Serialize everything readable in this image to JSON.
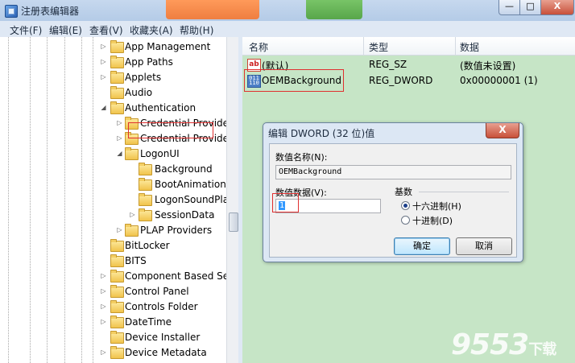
{
  "window": {
    "title": "注册表编辑器",
    "min": "—",
    "max": "□",
    "close": "X"
  },
  "menu": [
    "文件(F)",
    "编辑(E)",
    "查看(V)",
    "收藏夹(A)",
    "帮助(H)"
  ],
  "tree": [
    {
      "label": "App Management",
      "level": 0,
      "exp": "▷"
    },
    {
      "label": "App Paths",
      "level": 0,
      "exp": "▷"
    },
    {
      "label": "Applets",
      "level": 0,
      "exp": "▷"
    },
    {
      "label": "Audio",
      "level": 0,
      "exp": ""
    },
    {
      "label": "Authentication",
      "level": 0,
      "exp": "◢"
    },
    {
      "label": "Credential Provider",
      "level": 1,
      "exp": "▷"
    },
    {
      "label": "Credential Provider",
      "level": 1,
      "exp": "▷"
    },
    {
      "label": "LogonUI",
      "level": 1,
      "exp": "◢"
    },
    {
      "label": "Background",
      "level": 2,
      "exp": ""
    },
    {
      "label": "BootAnimation",
      "level": 2,
      "exp": ""
    },
    {
      "label": "LogonSoundPlay",
      "level": 2,
      "exp": ""
    },
    {
      "label": "SessionData",
      "level": 2,
      "exp": "▷"
    },
    {
      "label": "PLAP Providers",
      "level": 1,
      "exp": "▷"
    },
    {
      "label": "BitLocker",
      "level": 0,
      "exp": ""
    },
    {
      "label": "BITS",
      "level": 0,
      "exp": ""
    },
    {
      "label": "Component Based Ser",
      "level": 0,
      "exp": "▷"
    },
    {
      "label": "Control Panel",
      "level": 0,
      "exp": "▷"
    },
    {
      "label": "Controls Folder",
      "level": 0,
      "exp": "▷"
    },
    {
      "label": "DateTime",
      "level": 0,
      "exp": "▷"
    },
    {
      "label": "Device Installer",
      "level": 0,
      "exp": ""
    },
    {
      "label": "Device Metadata",
      "level": 0,
      "exp": "▷"
    }
  ],
  "list": {
    "headers": [
      "名称",
      "类型",
      "数据"
    ],
    "rows": [
      {
        "icon": "string-value-icon",
        "icon_text": "ab",
        "name": "(默认)",
        "type": "REG_SZ",
        "data": "(数值未设置)"
      },
      {
        "icon": "binary-value-icon",
        "icon_text": "011\n110",
        "name": "OEMBackground",
        "type": "REG_DWORD",
        "data": "0x00000001 (1)"
      }
    ]
  },
  "dialog": {
    "title": "编辑 DWORD (32 位)值",
    "close": "X",
    "name_label": "数值名称(N):",
    "name_value": "OEMBackground",
    "data_label": "数值数据(V):",
    "data_value": "1",
    "base_label": "基数",
    "hex_label": "十六进制(H)",
    "dec_label": "十进制(D)",
    "base_selected": "hex",
    "ok": "确定",
    "cancel": "取消"
  },
  "watermark": {
    "main": "9553",
    "suffix": "下载"
  }
}
